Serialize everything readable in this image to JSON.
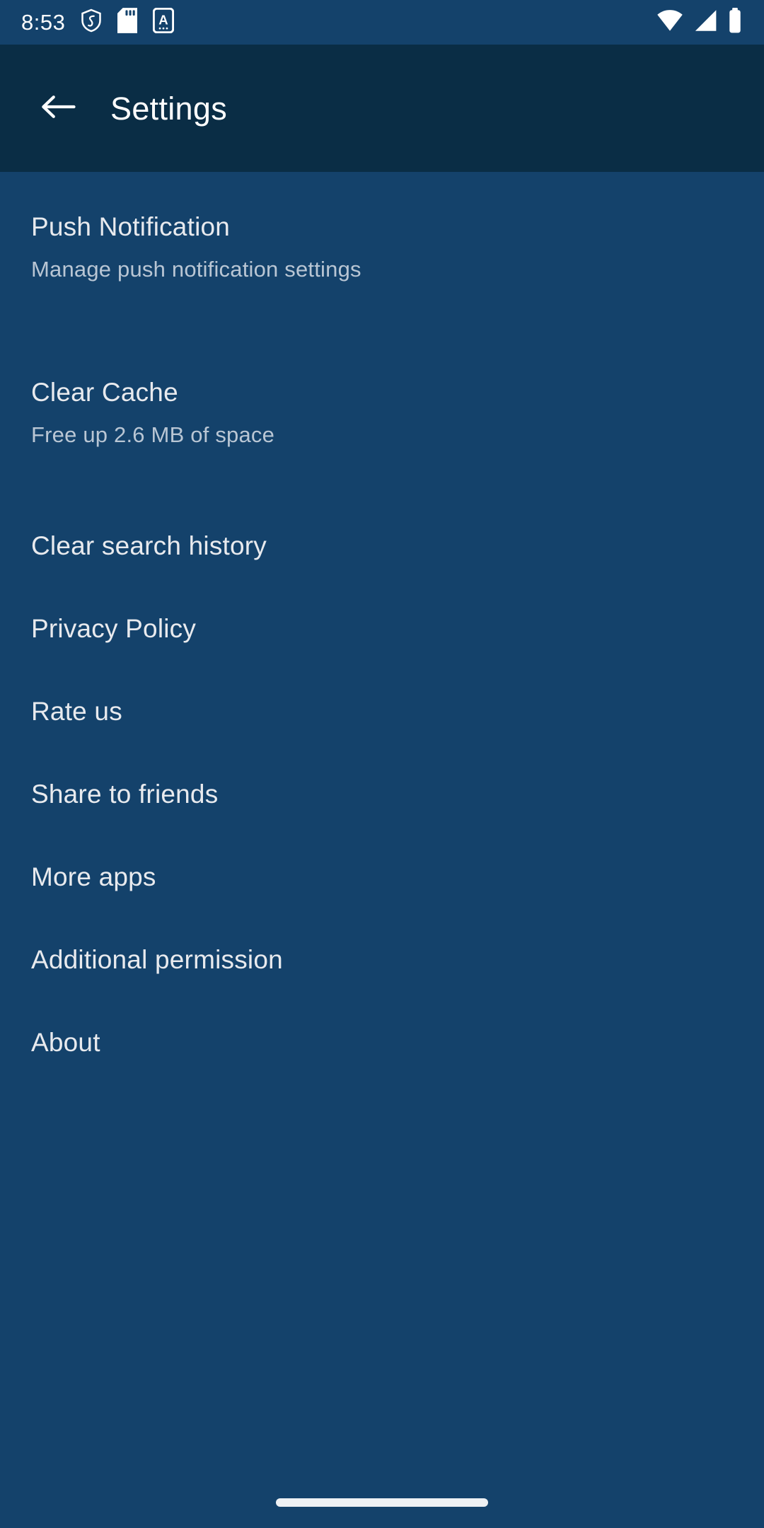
{
  "status_bar": {
    "time": "8:53",
    "left_icons": [
      {
        "name": "shield-icon",
        "label": "VPN / security shield"
      },
      {
        "name": "sd-card-icon",
        "label": "SD card"
      },
      {
        "name": "letter-a-badge-icon",
        "label": "A badge"
      }
    ],
    "right_icons": [
      {
        "name": "wifi-icon",
        "label": "Wi-Fi full signal"
      },
      {
        "name": "cellular-signal-icon",
        "label": "Mobile signal"
      },
      {
        "name": "battery-icon",
        "label": "Battery full"
      }
    ]
  },
  "app_bar": {
    "back_label": "Back",
    "title": "Settings"
  },
  "settings": {
    "items": [
      {
        "title": "Push Notification",
        "subtitle": "Manage push notification settings"
      },
      {
        "title": "Clear Cache",
        "subtitle": "Free up 2.6 MB of space"
      },
      {
        "title": "Clear search history",
        "subtitle": ""
      },
      {
        "title": "Privacy Policy",
        "subtitle": ""
      },
      {
        "title": "Rate us",
        "subtitle": ""
      },
      {
        "title": "Share to friends",
        "subtitle": ""
      },
      {
        "title": "More apps",
        "subtitle": ""
      },
      {
        "title": "Additional permission",
        "subtitle": ""
      },
      {
        "title": "About",
        "subtitle": ""
      }
    ]
  },
  "nav_bar": {
    "home_indicator_label": "Home gesture bar"
  },
  "colors": {
    "status_bar_bg": "#14426b",
    "app_bar_bg": "#0a2d45",
    "content_bg": "#14426b",
    "title_text": "#e8eaee",
    "subtitle_text": "#b9c6d4",
    "icon_white": "#ffffff"
  }
}
